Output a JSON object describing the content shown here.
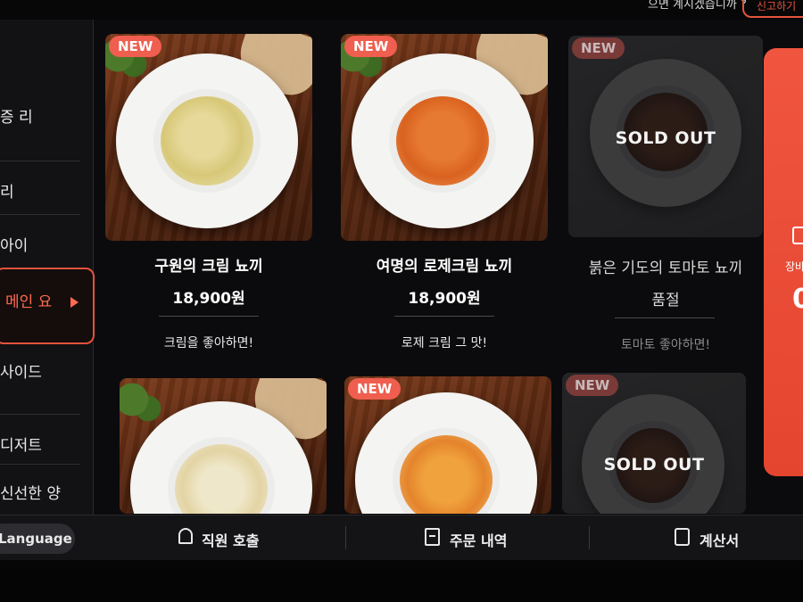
{
  "header": {
    "top_text": "으면 계시겠습니까 ?",
    "top_button": "신고하기"
  },
  "sidebar": {
    "items": [
      {
        "label": "증 리"
      },
      {
        "label": "리"
      },
      {
        "label": "아이"
      },
      {
        "label": "메인 요"
      },
      {
        "label": "사이드"
      },
      {
        "label": "디저트"
      },
      {
        "label": "신선한 양"
      }
    ]
  },
  "menu": {
    "items": [
      {
        "badge": "NEW",
        "name": "구원의 크림 뇨끼",
        "price": "18,900원",
        "desc": "크림을 좋아하면!",
        "status": ""
      },
      {
        "badge": "NEW",
        "name": "여명의 로제크림 뇨끼",
        "price": "18,900원",
        "desc": "로제 크림 그 맛!",
        "status": ""
      },
      {
        "badge": "NEW",
        "name": "붉은 기도의 토마토 뇨끼",
        "price": "품절",
        "desc": "토마토 좋아하면!",
        "status": "SOLD OUT"
      },
      {
        "badge": "",
        "name": "",
        "price": "",
        "desc": "",
        "status": ""
      },
      {
        "badge": "NEW",
        "name": "",
        "price": "",
        "desc": "",
        "status": ""
      },
      {
        "badge": "NEW",
        "name": "",
        "price": "",
        "desc": "",
        "status": "SOLD OUT"
      }
    ]
  },
  "promo": {
    "text": "장바",
    "big": "0"
  },
  "footer": {
    "language": "Language",
    "call_staff": "직원 호출",
    "order_history": "주문 내역",
    "bill": "계산서"
  },
  "icons": [
    "bell-icon",
    "receipt-icon",
    "bill-icon",
    "cart-icon",
    "arrow-right-icon"
  ],
  "colors": {
    "accent": "#e5533c",
    "badge": "#ef5e4e",
    "background": "#0b0b0d"
  }
}
